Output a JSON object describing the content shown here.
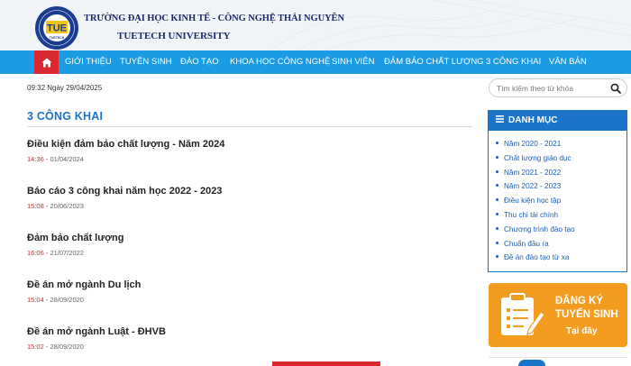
{
  "header": {
    "school_name_vi": "TRƯỜNG ĐẠI HỌC KINH TẾ - CÔNG NGHỆ THÁI NGUYÊN",
    "school_name_en": "TUETECH UNIVERSITY",
    "logo_text": "TUE",
    "logo_ring_text": "TUETECH"
  },
  "nav": {
    "items": [
      {
        "label": "GIỚI THIỆU"
      },
      {
        "label": "TUYỂN SINH"
      },
      {
        "label": "ĐÀO TẠO"
      },
      {
        "label": "KHOA HỌC CÔNG NGHỆ"
      },
      {
        "label": "SINH VIÊN"
      },
      {
        "label": "ĐẢM BẢO CHẤT LƯỢNG"
      },
      {
        "label": "3 CÔNG KHAI"
      },
      {
        "label": "VĂN BẢN"
      }
    ]
  },
  "datetime": "09:32 Ngày 29/04/2025",
  "search": {
    "placeholder": "Tìm kiếm theo từ khóa"
  },
  "main": {
    "section_title": "3 CÔNG KHAI",
    "articles": [
      {
        "title": "Điều kiện đảm bảo chất lượng - Năm 2024",
        "time": "14:36",
        "date": " - 01/04/2024"
      },
      {
        "title": "Báo cáo 3 công khai năm học 2022 - 2023",
        "time": "15:08",
        "date": " - 20/06/2023"
      },
      {
        "title": "Đảm bảo chất lượng",
        "time": "16:06",
        "date": " - 21/07/2022"
      },
      {
        "title": "Đề án mở ngành Du lịch",
        "time": "15:04",
        "date": " - 28/09/2020"
      },
      {
        "title": "Đề án mở ngành Luật - ĐHVB",
        "time": "15:02",
        "date": " - 28/09/2020"
      }
    ]
  },
  "sidebar": {
    "heading": "DANH MỤC",
    "items": [
      {
        "label": "Năm 2020 - 2021"
      },
      {
        "label": "Chất lượng giáo dục"
      },
      {
        "label": "Năm 2021 - 2022"
      },
      {
        "label": "Năm 2022 - 2023"
      },
      {
        "label": "Điều kiện học tập"
      },
      {
        "label": "Thu chi tài chính"
      },
      {
        "label": "Chương trình đào tạo"
      },
      {
        "label": "Chuẩn đầu ra"
      },
      {
        "label": "Đề án đào tạo từ xa"
      }
    ],
    "banner": {
      "line1": "ĐĂNG KÝ",
      "line2": "TUYỂN SINH",
      "line3": "Tại đây"
    }
  },
  "colors": {
    "nav_blue": "#1a9be4",
    "home_red": "#d9282f",
    "title_blue": "#1a74c9",
    "banner_orange": "#f39c1f"
  }
}
